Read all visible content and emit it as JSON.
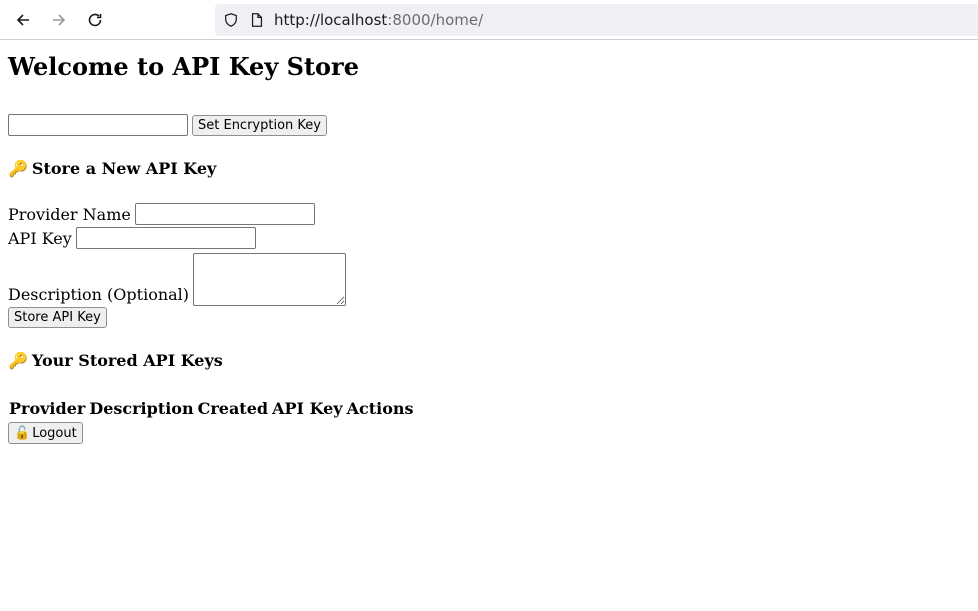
{
  "browser": {
    "url_host": "http://localhost",
    "url_rest": ":8000/home/"
  },
  "page": {
    "heading": "Welcome to API Key Store",
    "encryption_key_button": "Set Encryption Key",
    "store_section_icon": "🔑",
    "store_section_title": "Store a New API Key",
    "provider_label": "Provider Name",
    "api_key_label": "API Key",
    "description_label": "Description (Optional)",
    "store_button": "Store API Key",
    "stored_section_icon": "🔑",
    "stored_section_title": "Your Stored API Keys",
    "table_headers": [
      "Provider",
      "Description",
      "Created",
      "API Key",
      "Actions"
    ],
    "logout_icon": "🔓",
    "logout_label": "Logout"
  }
}
